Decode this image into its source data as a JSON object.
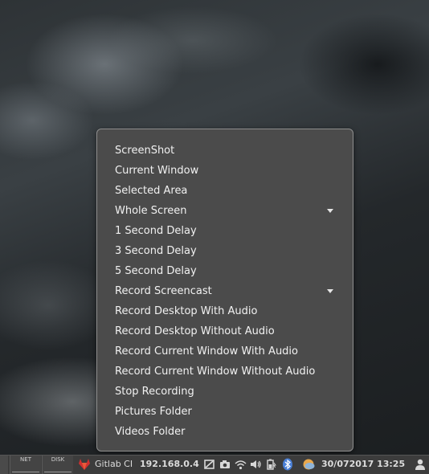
{
  "menu": {
    "items": [
      {
        "label": "ScreenShot",
        "has_submenu": false
      },
      {
        "label": "Current Window",
        "has_submenu": false
      },
      {
        "label": "Selected Area",
        "has_submenu": false
      },
      {
        "label": "Whole Screen",
        "has_submenu": true
      },
      {
        "label": "1 Second Delay",
        "has_submenu": false
      },
      {
        "label": "3 Second Delay",
        "has_submenu": false
      },
      {
        "label": "5 Second Delay",
        "has_submenu": false
      },
      {
        "label": "Record Screencast",
        "has_submenu": true
      },
      {
        "label": "Record Desktop With Audio",
        "has_submenu": false
      },
      {
        "label": "Record Desktop Without Audio",
        "has_submenu": false
      },
      {
        "label": "Record Current Window With Audio",
        "has_submenu": false
      },
      {
        "label": "Record Current Window Without Audio",
        "has_submenu": false
      },
      {
        "label": "Stop Recording",
        "has_submenu": false
      },
      {
        "label": "Pictures Folder",
        "has_submenu": false
      },
      {
        "label": "Videos Folder",
        "has_submenu": false
      }
    ]
  },
  "taskbar": {
    "net_label": "NET",
    "disk_label": "DISK",
    "gitlab_label": "Gitlab CI",
    "ip_address": "192.168.0.4",
    "datetime": "30/072017 13:25",
    "icons": [
      "gitlab-icon",
      "screen-lock-icon",
      "camera-icon",
      "wifi-icon",
      "volume-icon",
      "battery-icon",
      "bluetooth-icon",
      "weather-icon",
      "user-icon"
    ]
  },
  "colors": {
    "menu_bg": "#4b4b4b",
    "menu_border": "#8e8e8e",
    "menu_text": "#f1f1f1",
    "taskbar_bg": "#3c3c3c",
    "gitlab_red": "#d03030",
    "bluetooth_blue": "#4a7fd6"
  }
}
